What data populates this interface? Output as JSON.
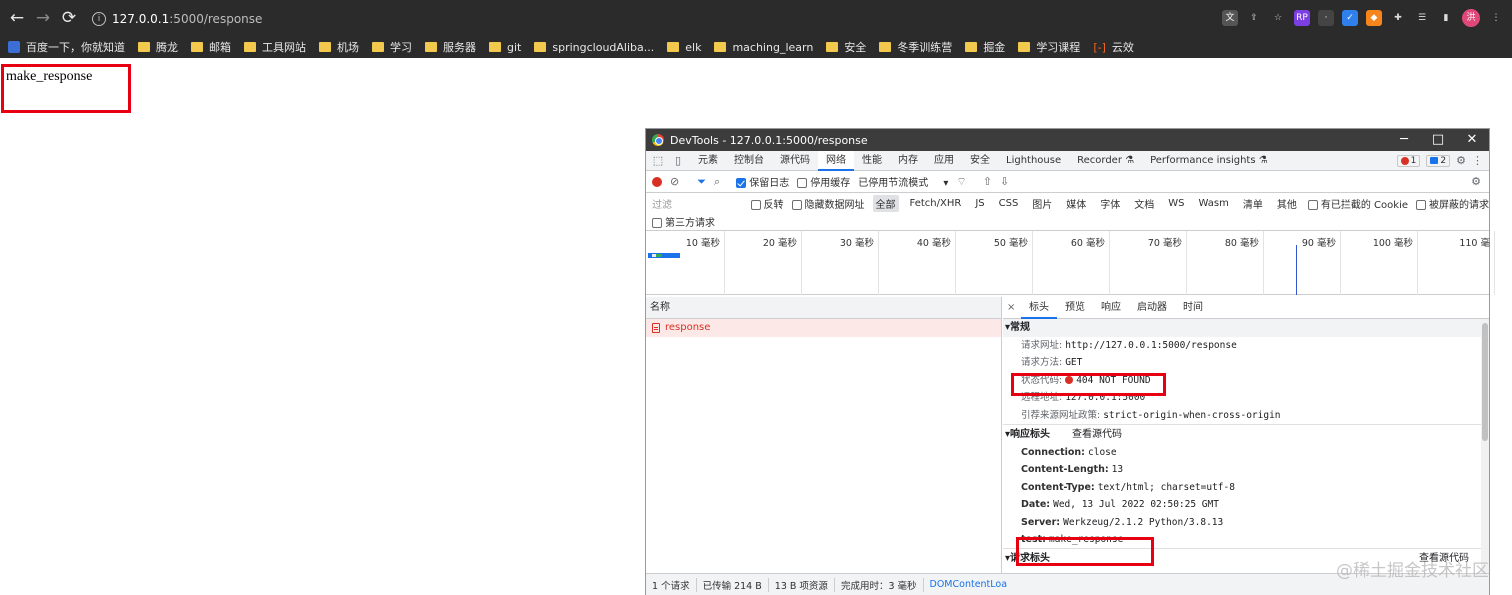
{
  "browser": {
    "nav": {
      "back": "←",
      "forward": "→",
      "reload": "⟳"
    },
    "url_host": "127.0.0.1",
    "url_rest": ":5000/response",
    "avatar_text": "洪"
  },
  "bookmarks": [
    {
      "label": "百度一下，你就知道",
      "icon": "baidu-icon"
    },
    {
      "label": "腾龙",
      "icon": "folder-icon"
    },
    {
      "label": "邮箱",
      "icon": "folder-icon"
    },
    {
      "label": "工具网站",
      "icon": "folder-icon"
    },
    {
      "label": "机场",
      "icon": "folder-icon"
    },
    {
      "label": "学习",
      "icon": "folder-icon"
    },
    {
      "label": "服务器",
      "icon": "folder-icon"
    },
    {
      "label": "git",
      "icon": "folder-icon"
    },
    {
      "label": "springcloudAliba...",
      "icon": "folder-icon"
    },
    {
      "label": "elk",
      "icon": "folder-icon"
    },
    {
      "label": "maching_learn",
      "icon": "folder-icon"
    },
    {
      "label": "安全",
      "icon": "folder-icon"
    },
    {
      "label": "冬季训练营",
      "icon": "folder-icon"
    },
    {
      "label": "掘金",
      "icon": "folder-icon"
    },
    {
      "label": "学习课程",
      "icon": "folder-icon"
    },
    {
      "label": "云效",
      "icon": "cloud-icon"
    }
  ],
  "page": {
    "body_text": "make_response"
  },
  "devtools": {
    "title": "DevTools - 127.0.0.1:5000/response",
    "tabs": [
      "元素",
      "控制台",
      "源代码",
      "网络",
      "性能",
      "内存",
      "应用",
      "安全",
      "Lighthouse",
      "Recorder ⚗",
      "Performance insights ⚗"
    ],
    "active_tab": "网络",
    "error_count": "1",
    "message_count": "2",
    "network_toolbar": {
      "preserve_log": "保留日志",
      "disable_cache": "停用缓存",
      "throttling": "已停用节流模式"
    },
    "filter": {
      "placeholder": "过滤",
      "invert": "反转",
      "hide_data_urls": "隐藏数据网址",
      "types": [
        "全部",
        "Fetch/XHR",
        "JS",
        "CSS",
        "图片",
        "媒体",
        "字体",
        "文档",
        "WS",
        "Wasm",
        "清单",
        "其他"
      ],
      "blocked_cookies": "有已拦截的 Cookie",
      "blocked_requests": "被屏蔽的请求",
      "third_party": "第三方请求"
    },
    "timeline_ticks": [
      "10 毫秒",
      "20 毫秒",
      "30 毫秒",
      "40 毫秒",
      "50 毫秒",
      "60 毫秒",
      "70 毫秒",
      "80 毫秒",
      "90 毫秒",
      "100 毫秒",
      "110 毫"
    ],
    "request_list": {
      "header": "名称",
      "items": [
        "response"
      ]
    },
    "detail": {
      "close": "×",
      "tabs": [
        "标头",
        "预览",
        "响应",
        "启动器",
        "时间"
      ],
      "general": {
        "title": "▾常规",
        "request_url_label": "请求网址:",
        "request_url": "http://127.0.0.1:5000/response",
        "method_label": "请求方法:",
        "method": "GET",
        "status_label": "状态代码:",
        "status": "404 NOT FOUND",
        "remote_label": "远程地址:",
        "remote": "127.0.0.1:5000",
        "referrer_label": "引荐来源网址政策:",
        "referrer": "strict-origin-when-cross-origin"
      },
      "response_headers": {
        "title": "▾响应标头",
        "view_source": "查看源代码",
        "items": [
          {
            "k": "Connection:",
            "v": "close"
          },
          {
            "k": "Content-Length:",
            "v": "13"
          },
          {
            "k": "Content-Type:",
            "v": "text/html; charset=utf-8"
          },
          {
            "k": "Date:",
            "v": "Wed, 13 Jul 2022 02:50:25 GMT"
          },
          {
            "k": "Server:",
            "v": "Werkzeug/2.1.2 Python/3.8.13"
          },
          {
            "k": "test:",
            "v": "make_response"
          }
        ]
      },
      "request_headers": {
        "title": "▾请求标头",
        "view_source": "查看源代码"
      }
    },
    "statusbar": [
      "1 个请求",
      "已传输 214 B",
      "13 B 项资源",
      "完成用时：3 毫秒",
      "DOMContentLoa"
    ]
  },
  "watermark": "@稀土掘金技术社区"
}
